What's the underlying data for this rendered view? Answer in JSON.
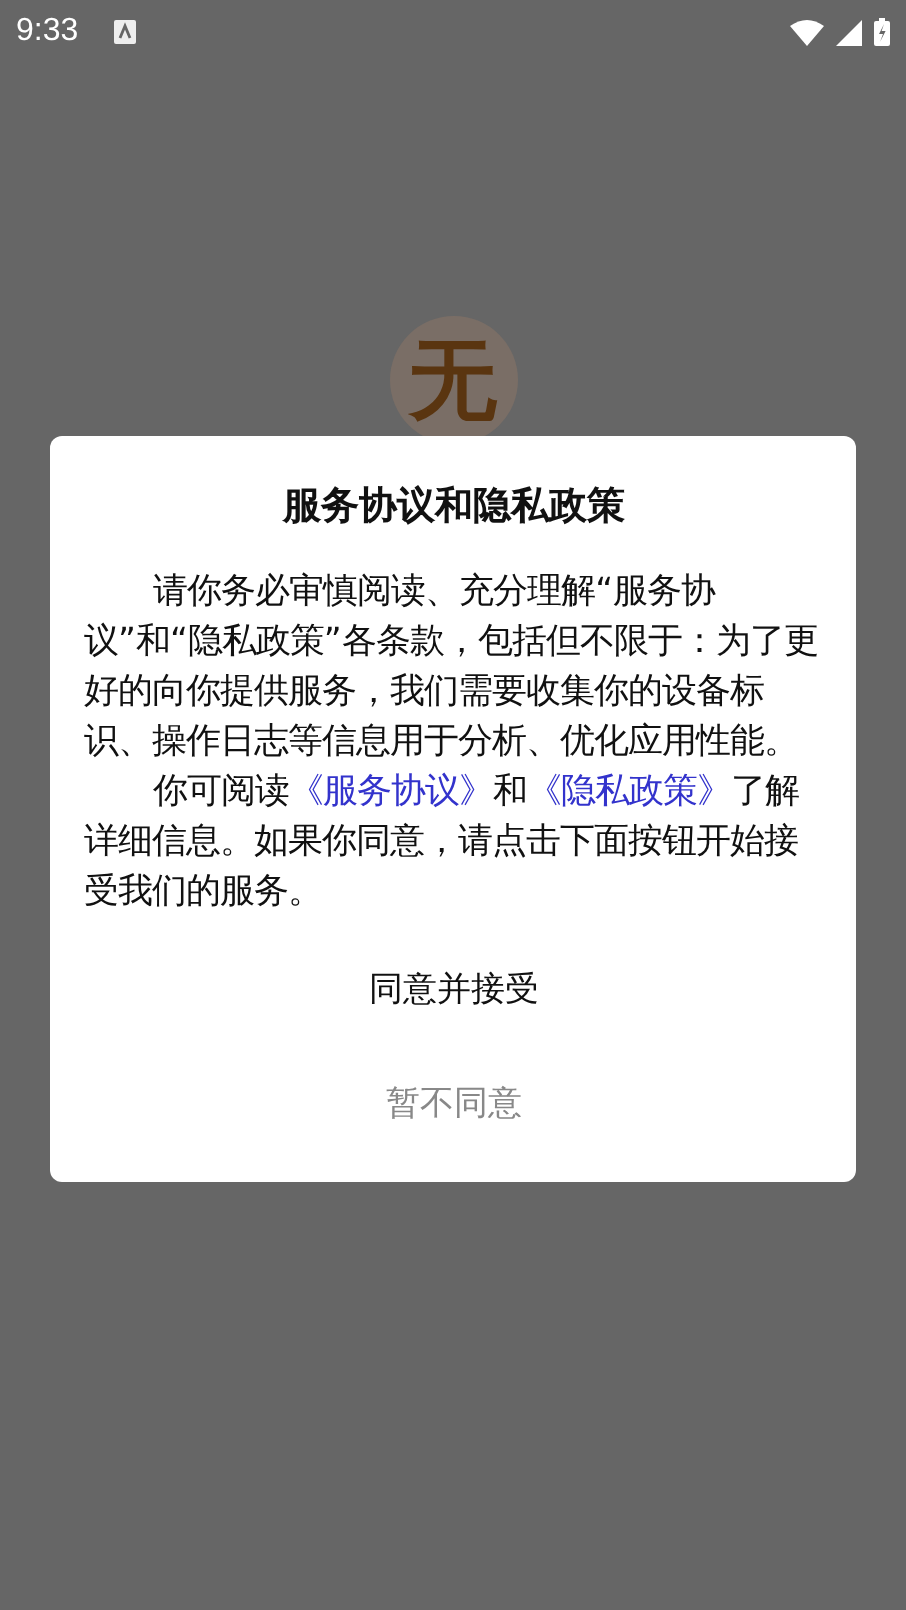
{
  "status_bar": {
    "time": "9:33"
  },
  "logo": {
    "text": "无"
  },
  "dialog": {
    "title": "服务协议和隐私政策",
    "paragraphs": [
      [
        {
          "kind": "text",
          "text": "请你务必审慎阅读、充分理解“服务协议”和“隐私政策”各条款，包括但不限于：为了更好的向你提供服务，我们需要收集你的设备标识、操作日志等信息用于分析、优化应用性能。"
        }
      ],
      [
        {
          "kind": "text",
          "text": "你可阅读"
        },
        {
          "kind": "link",
          "text": "《服务协议》"
        },
        {
          "kind": "text",
          "text": "和"
        },
        {
          "kind": "link",
          "text": "《隐私政策》"
        },
        {
          "kind": "text",
          "text": "了解详细信息。如果你同意，请点击下面按钮开始接受我们的服务。"
        }
      ]
    ],
    "buttons": [
      {
        "label": "同意并接受",
        "kind": "primary"
      },
      {
        "label": "暂不同意",
        "kind": "secondary"
      }
    ]
  }
}
